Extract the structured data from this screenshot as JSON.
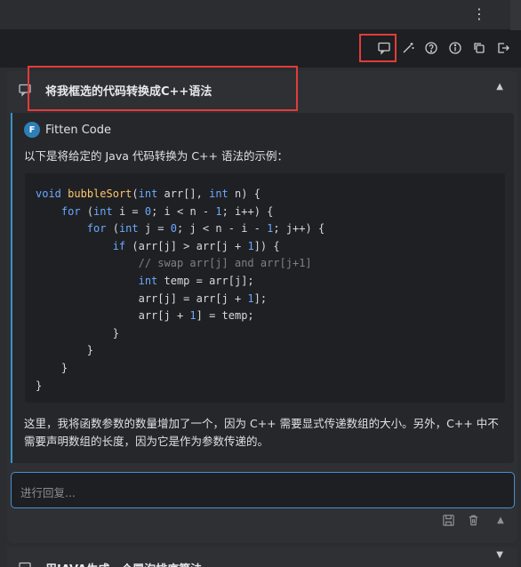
{
  "topbar": {
    "more_icon": "more-vertical-icon"
  },
  "toolbar": {
    "icons": [
      "chat-bubble-icon",
      "magic-wand-icon",
      "help-icon",
      "info-icon",
      "copy-icon",
      "exit-icon"
    ]
  },
  "section": {
    "title": "将我框选的代码转换成C++语法",
    "icon": "chat-bubble-icon",
    "caret": "▲"
  },
  "answer": {
    "author": "Fitten Code",
    "intro": "以下是将给定的 Java 代码转换为 C++ 语法的示例：",
    "explanation": "这里，我将函数参数的数量增加了一个，因为 C++ 需要显式传递数组的大小。另外，C++ 中不需要声明数组的长度，因为它是作为参数传递的。"
  },
  "code": {
    "lines": [
      "void bubbleSort(int arr[], int n) {",
      "    for (int i = 0; i < n - 1; i++) {",
      "        for (int j = 0; j < n - i - 1; j++) {",
      "            if (arr[j] > arr[j + 1]) {",
      "                // swap arr[j] and arr[j+1]",
      "                int temp = arr[j];",
      "                arr[j] = arr[j + 1];",
      "                arr[j + 1] = temp;",
      "            }",
      "        }",
      "    }",
      "}"
    ]
  },
  "reply": {
    "placeholder": "进行回复..."
  },
  "actions": {
    "icons": [
      "save-icon",
      "trash-icon",
      "caret-up-icon"
    ]
  },
  "next_section": {
    "title": "用JAVA生成一个冒泡排序算法",
    "caret": "▼"
  },
  "colors": {
    "accent": "#3b8fc5",
    "highlight": "#e33b3b"
  }
}
